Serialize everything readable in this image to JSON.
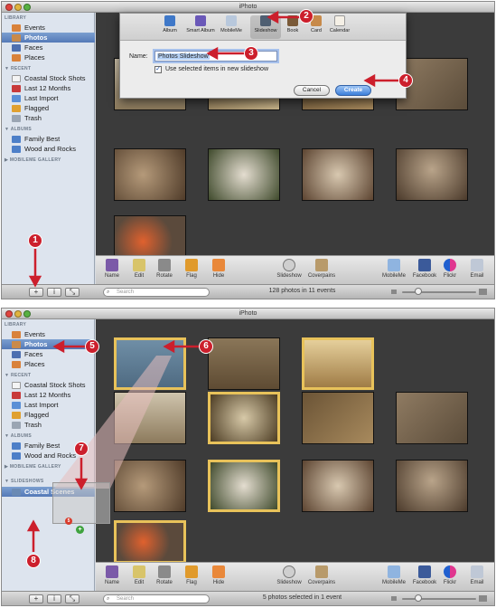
{
  "window1": {
    "title": "iPhoto",
    "sidebar": {
      "library_header": "LIBRARY",
      "library_items": [
        {
          "label": "Events",
          "icon": "events-icon"
        },
        {
          "label": "Photos",
          "icon": "photos-icon"
        },
        {
          "label": "Faces",
          "icon": "faces-icon"
        },
        {
          "label": "Places",
          "icon": "places-icon"
        }
      ],
      "recent_header": "RECENT",
      "recent_items": [
        {
          "label": "Coastal Stock Shots",
          "icon": "album-icon"
        },
        {
          "label": "Last 12 Months",
          "icon": "calendar-icon"
        },
        {
          "label": "Last Import",
          "icon": "import-icon"
        },
        {
          "label": "Flagged",
          "icon": "flag-icon"
        },
        {
          "label": "Trash",
          "icon": "trash-icon"
        }
      ],
      "albums_header": "ALBUMS",
      "album_items": [
        {
          "label": "Family Best",
          "icon": "album-icon"
        },
        {
          "label": "Wood and Rocks",
          "icon": "album-icon"
        }
      ],
      "gallery_header": "MOBILEME GALLERY"
    },
    "dialog": {
      "tabs": [
        {
          "label": "Album"
        },
        {
          "label": "Smart Album"
        },
        {
          "label": "MobileMe"
        },
        {
          "label": "Slideshow"
        },
        {
          "label": "Book"
        },
        {
          "label": "Card"
        },
        {
          "label": "Calendar"
        }
      ],
      "name_label": "Name:",
      "name_value": "Photos Slideshow",
      "checkbox_label": "Use selected items in new slideshow",
      "cancel_label": "Cancel",
      "create_label": "Create"
    },
    "status_text": "128 photos in 11 events",
    "search_placeholder": "Search"
  },
  "window2": {
    "title": "iPhoto",
    "sidebar": {
      "library_header": "LIBRARY",
      "library_items": [
        {
          "label": "Events",
          "icon": "events-icon"
        },
        {
          "label": "Photos",
          "icon": "photos-icon"
        },
        {
          "label": "Faces",
          "icon": "faces-icon"
        },
        {
          "label": "Places",
          "icon": "places-icon"
        }
      ],
      "recent_header": "RECENT",
      "recent_items": [
        {
          "label": "Coastal Stock Shots",
          "icon": "album-icon"
        },
        {
          "label": "Last 12 Months",
          "icon": "calendar-icon"
        },
        {
          "label": "Last Import",
          "icon": "import-icon"
        },
        {
          "label": "Flagged",
          "icon": "flag-icon"
        },
        {
          "label": "Trash",
          "icon": "trash-icon"
        }
      ],
      "albums_header": "ALBUMS",
      "album_items": [
        {
          "label": "Family Best",
          "icon": "album-icon"
        },
        {
          "label": "Wood and Rocks",
          "icon": "album-icon"
        }
      ],
      "gallery_header": "MOBILEME GALLERY",
      "slideshows_header": "SLIDESHOWS",
      "slideshow_items": [
        {
          "label": "Coastal Scenes",
          "icon": "slideshow-icon"
        }
      ],
      "drag_badge_count": "5"
    },
    "status_text": "5 photos selected in 1 event",
    "search_placeholder": "Search"
  },
  "toolbar": {
    "left_items": [
      {
        "label": "Name",
        "icon": "info-icon"
      },
      {
        "label": "Edit",
        "icon": "pencil-icon"
      },
      {
        "label": "Rotate",
        "icon": "rotate-icon"
      },
      {
        "label": "Flag",
        "icon": "flag-icon"
      },
      {
        "label": "Hide",
        "icon": "hide-icon"
      }
    ],
    "center_items": [
      {
        "label": "Slideshow",
        "icon": "play-icon"
      },
      {
        "label": "Coverpains",
        "icon": "coverpains-icon"
      }
    ],
    "right_items": [
      {
        "label": "MobileMe",
        "icon": "mobileme-icon"
      },
      {
        "label": "Facebook",
        "icon": "facebook-icon"
      },
      {
        "label": "Flickr",
        "icon": "flickr-icon"
      },
      {
        "label": "Email",
        "icon": "email-icon"
      }
    ]
  },
  "callouts": [
    "1",
    "2",
    "3",
    "4",
    "5",
    "6",
    "7",
    "8"
  ],
  "colors": {
    "callout_red": "#cc1f2c",
    "selection_yellow": "#e8c25a",
    "sidebar_bg": "#dde4ee",
    "sidebar_selected": "#5479b7"
  }
}
